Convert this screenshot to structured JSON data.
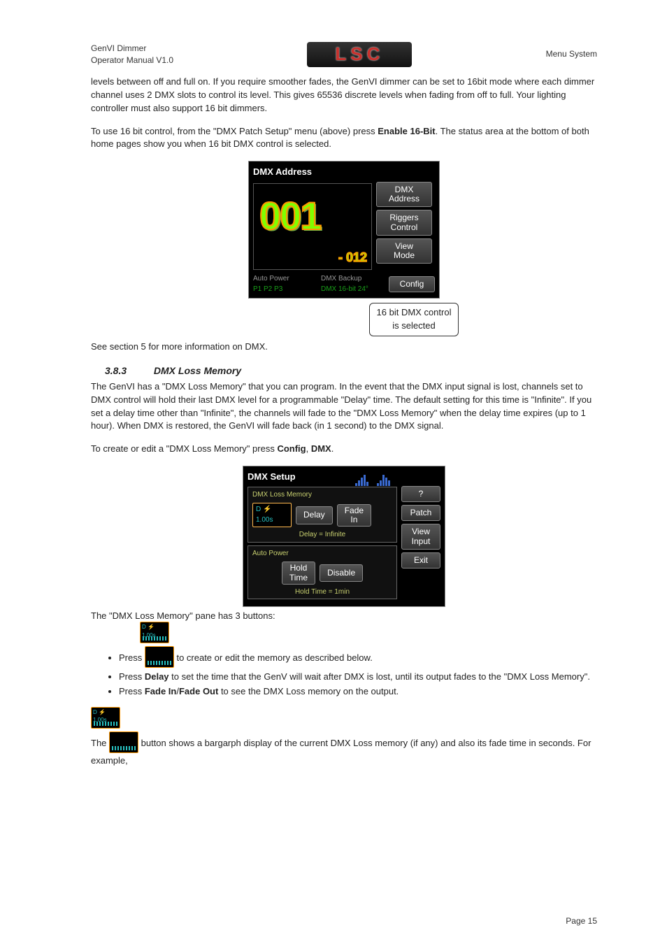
{
  "header": {
    "left": "GenVI Dimmer\nOperator Manual V1.0",
    "logo_text": "LSC",
    "right": "Menu System"
  },
  "p1": "levels between off and full on. If you require smoother fades, the GenVI dimmer can be set to 16bit mode where each dimmer channel uses 2 DMX slots to control its level. This gives 65536 discrete levels when fading from off to full. Your lighting controller must also support 16 bit dimmers.",
  "p2a": "To use 16 bit control, from the \"DMX Patch Setup\" menu (above) press ",
  "p2b": "Enable 16-Bit",
  "p2c": ". The status area at the bottom of both home pages show you when 16 bit DMX control is selected.",
  "shot1": {
    "title": "DMX Address",
    "big_number": "001",
    "dash_num": "- 012",
    "buttons": {
      "b1": "DMX\nAddress",
      "b2": "Riggers\nControl",
      "b3": "View\nMode",
      "b4": "Config"
    },
    "status_left_title": "Auto Power",
    "status_left_vals": "P1  P2  P3",
    "status_mid_title": "DMX Backup",
    "status_mid_vals": "DMX 16-bit  24°",
    "callout": "16 bit DMX control\nis selected"
  },
  "p3": "See section 5 for more information on DMX.",
  "section": {
    "num": "3.8.3",
    "title": "DMX Loss Memory"
  },
  "p4": "The GenVI has a \"DMX Loss Memory\" that you can program. In the event that the DMX input signal is lost, channels set to DMX control will hold their last DMX level for a programmable \"Delay\" time.  The default setting for this time is \"Infinite\". If you set a delay time other than \"Infinite\", the channels will fade to the \"DMX Loss Memory\" when the delay time expires (up to 1 hour). When DMX is restored, the GenVI will fade back (in 1 second) to the DMX signal.",
  "p5a": "To create or edit a \"DMX Loss Memory\" press ",
  "p5b": "Config",
  "p5c": ", ",
  "p5d": "DMX",
  "p5e": ".",
  "shot2": {
    "title": "DMX Setup",
    "pane1_label": "DMX Loss Memory",
    "mini_btn_text": "D   ⚡ 1.00s",
    "delay_btn": "Delay",
    "fade_btn": "Fade\nIn",
    "delay_caption": "Delay = Infinite",
    "pane2_label": "Auto Power",
    "hold_btn": "Hold\nTime",
    "disable_btn": "Disable",
    "hold_caption": "Hold Time = 1min",
    "side": {
      "help": "?",
      "patch": "Patch",
      "view": "View\nInput",
      "exit": "Exit"
    }
  },
  "p6": "The \"DMX Loss Memory\" pane has 3 buttons:",
  "bullets": {
    "b1a": "Press ",
    "b1b": " to create or edit the memory as described below.",
    "b2a": "Press ",
    "b2b": "Delay",
    "b2c": " to set the time that the GenV will wait after DMX is lost, until its output fades to the \"DMX Loss Memory\".",
    "b3a": "Press ",
    "b3b": "Fade In",
    "b3c": "/",
    "b3d": "Fade Out",
    "b3e": " to see the DMX Loss memory on the output."
  },
  "p7a": "The ",
  "p7b": " button shows a bargarph display of the current DMX Loss memory (if any) and also its fade time in seconds. For example,",
  "mini_label": "D  ⚡ 1.00s",
  "page_num": "Page 15"
}
